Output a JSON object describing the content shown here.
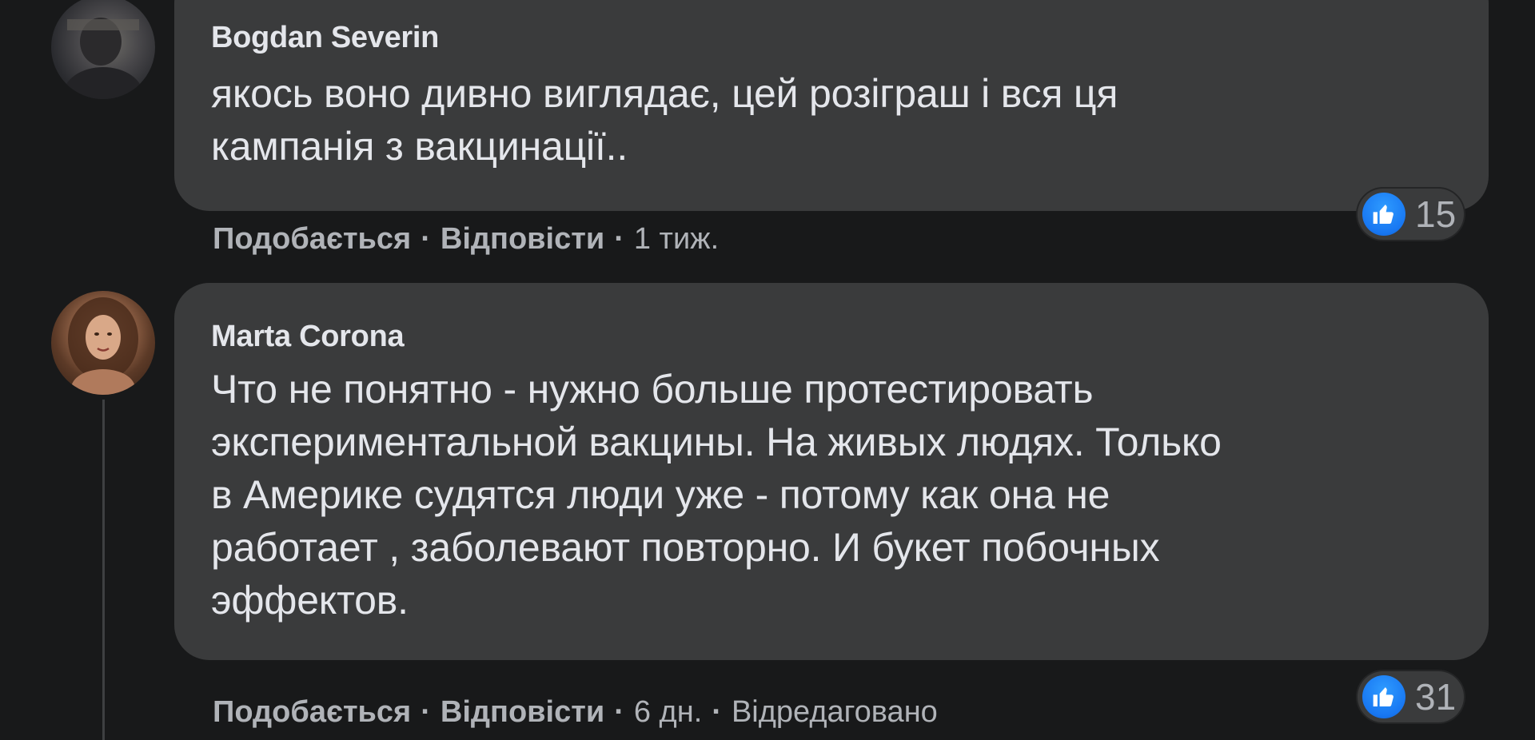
{
  "comments": [
    {
      "author": "Bogdan Severin",
      "text_lines": [
        "якось воно дивно виглядає, цей розіграш і вся ця",
        "кампанія з вакцинації.."
      ],
      "reaction_icon": "like-icon",
      "reaction_count": "15",
      "actions": {
        "like": "Подобається",
        "reply": "Відповісти",
        "time": "1 тиж.",
        "separator": "·"
      }
    },
    {
      "author": "Marta Corona",
      "text_lines": [
        "Что не понятно - нужно больше протестировать",
        "экспериментальной вакцины. На живых людях. Только",
        "в Америке судятся люди уже - потому как она не",
        "работает , заболевают повторно. И букет побочных",
        "эффектов."
      ],
      "reaction_icon": "like-icon",
      "reaction_count": "31",
      "actions": {
        "like": "Подобається",
        "reply": "Відповісти",
        "time": "6 дн.",
        "edited": "Відредаговано",
        "separator": "·"
      }
    }
  ],
  "colors": {
    "background": "#18191a",
    "bubble": "#3a3b3c",
    "primary_text": "#e4e6eb",
    "secondary_text": "#b0b3b8",
    "like_blue": "#1877f2"
  }
}
